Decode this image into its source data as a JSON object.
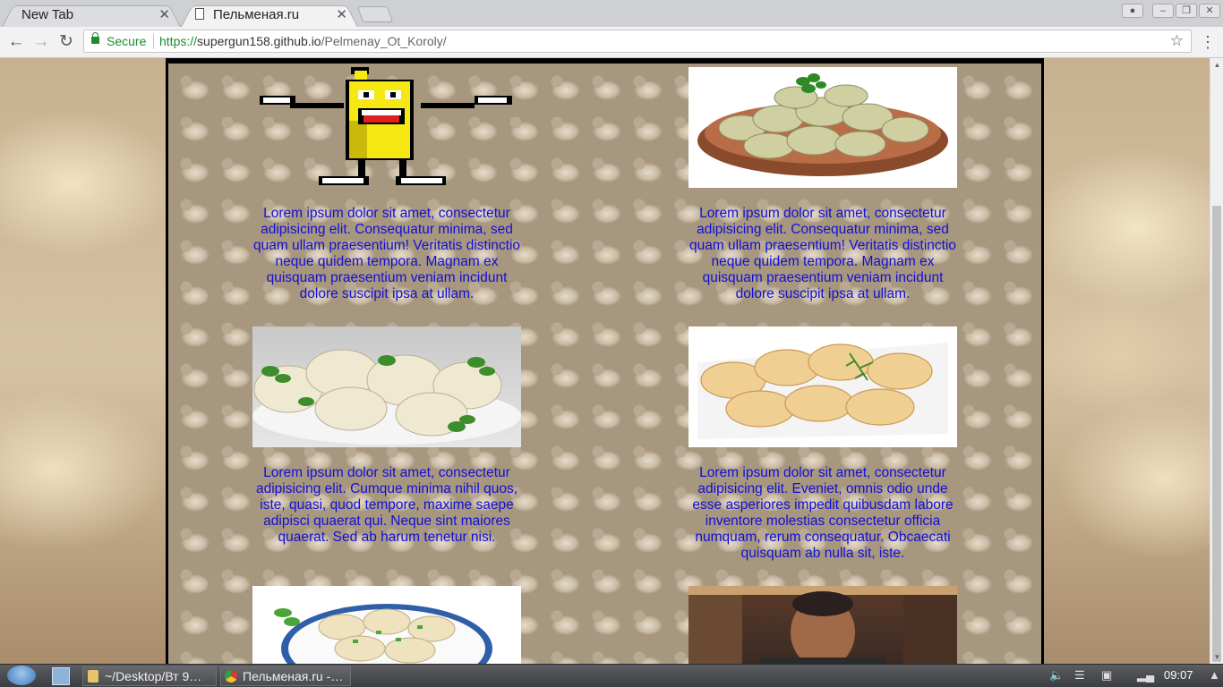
{
  "browser": {
    "tabs": [
      {
        "title": "New Tab",
        "active": false
      },
      {
        "title": "Пельменая.ru",
        "active": true
      }
    ],
    "close_glyph": "✕",
    "address": {
      "secure_label": "Secure",
      "scheme": "https://",
      "host": "supergun158.github.io",
      "path": "/Pelmenay_Ot_Koroly/"
    }
  },
  "page": {
    "cells": [
      {
        "image": "dancing-banana-icon",
        "caption": "Lorem ipsum dolor sit amet, consectetur adipisicing elit. Consequatur minima, sed quam ullam praesentium! Veritatis distinctio neque quidem tempora. Magnam ex quisquam praesentium veniam incidunt dolore suscipit ipsa at ullam."
      },
      {
        "image": "dumplings-in-clay-bowl",
        "caption": "Lorem ipsum dolor sit amet, consectetur adipisicing elit. Consequatur minima, sed quam ullam praesentium! Veritatis distinctio neque quidem tempora. Magnam ex quisquam praesentium veniam incidunt dolore suscipit ipsa at ullam."
      },
      {
        "image": "khinkali-with-parsley",
        "caption": "Lorem ipsum dolor sit amet, consectetur adipisicing elit. Cumque minima nihil quos, iste, quasi, quod tempore, maxime saepe adipisci quaerat qui. Neque sint maiores quaerat. Sed ab harum tenetur nisi."
      },
      {
        "image": "pelmeni-with-dill",
        "caption": "Lorem ipsum dolor sit amet, consectetur adipisicing elit. Eveniet, omnis odio unde esse asperiores impedit quibusdam labore inventore molestias consectetur officia numquam, rerum consequatur. Obcaecati quisquam ab nulla sit, iste."
      },
      {
        "image": "pelmeni-with-green-onion",
        "caption": ""
      },
      {
        "image": "man-photo",
        "caption": ""
      }
    ]
  },
  "taskbar": {
    "items": [
      {
        "label": "~/Desktop/Вт 9…"
      },
      {
        "label": "Пельменая.ru -…"
      }
    ],
    "clock": "09:07"
  }
}
